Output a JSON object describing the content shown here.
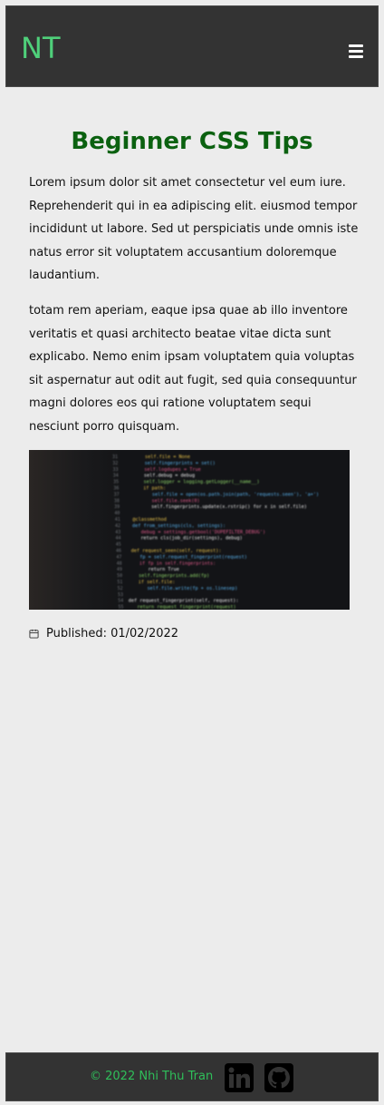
{
  "header": {
    "logo_text": "NT",
    "menu_icon": "hamburger-menu-icon"
  },
  "article": {
    "title": "Beginner CSS Tips",
    "paragraphs": [
      "Lorem ipsum dolor sit amet consectetur vel eum iure. Reprehenderit qui in ea adipiscing elit. eiusmod tempor incididunt ut labore. Sed ut perspiciatis unde omnis iste natus error sit voluptatem accusantium doloremque laudantium.",
      "totam rem aperiam, eaque ipsa quae ab illo inventore veritatis et quasi architecto beatae vitae dicta sunt explicabo. Nemo enim ipsam voluptatem quia voluptas sit aspernatur aut odit aut fugit, sed quia consequuntur magni dolores eos qui ratione voluptatem sequi nesciunt porro quisquam."
    ],
    "image_subject": "blurred-code-editor-screenshot",
    "code_lines": [
      "self.file = None",
      "self.fingerprints = set()",
      "self.logdupes = True",
      "self.debug = debug",
      "self.logger = logging.getLogger(__name__)",
      "if path:",
      "self.file = open(os.path.join(path, 'requests.seen'), 'a+')",
      "self.file.seek(0)",
      "self.fingerprints.update(x.rstrip() for x in self.file)",
      "",
      "@classmethod",
      "def from_settings(cls, settings):",
      "debug = settings.getbool('DUPEFILTER_DEBUG')",
      "return cls(job_dir(settings), debug)",
      "",
      "def request_seen(self, request):",
      "fp = self.request_fingerprint(request)",
      "if fp in self.fingerprints:",
      "return True",
      "self.fingerprints.add(fp)",
      "if self.file:",
      "self.file.write(fp + os.linesep)",
      "",
      "def request_fingerprint(self, request):",
      "return request_fingerprint(request)"
    ],
    "line_numbers": [
      "31",
      "32",
      "33",
      "34",
      "35",
      "36",
      "37",
      "38",
      "39",
      "40",
      "41",
      "42",
      "43",
      "44",
      "45",
      "46",
      "47",
      "48",
      "49",
      "50",
      "51",
      "52",
      "53",
      "54",
      "55"
    ],
    "published_label": "Published: 01/02/2022",
    "published_icon": "calendar-icon"
  },
  "footer": {
    "copyright": "© 2022 Nhi Thu Tran",
    "social": [
      {
        "icon": "linkedin-icon"
      },
      {
        "icon": "github-icon"
      }
    ]
  },
  "colors": {
    "header_bg": "#333333",
    "logo": "#4fd07a",
    "title": "#0b6110",
    "page_bg": "#ececec",
    "footer_text": "#2fbf5a"
  }
}
